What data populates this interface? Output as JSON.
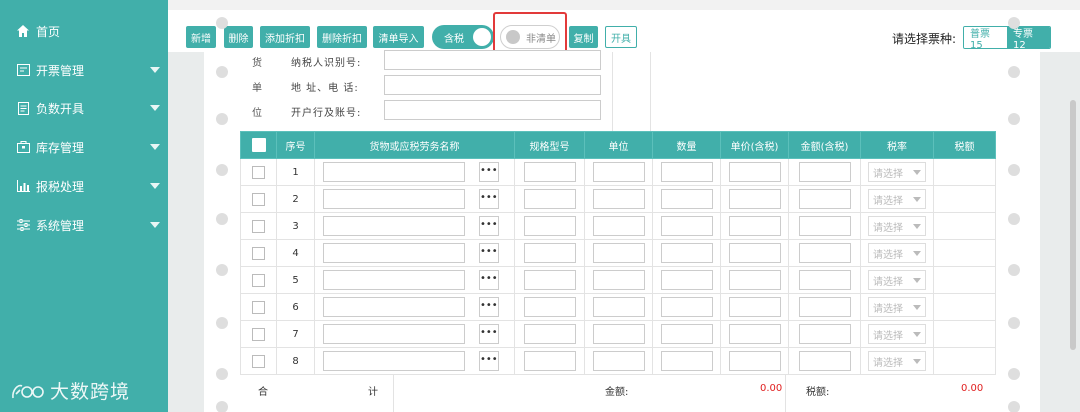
{
  "sidebar": {
    "items": [
      {
        "label": "首页",
        "icon": "home-icon",
        "has_caret": false
      },
      {
        "label": "开票管理",
        "icon": "invoice-icon",
        "has_caret": true
      },
      {
        "label": "负数开具",
        "icon": "document-icon",
        "has_caret": true
      },
      {
        "label": "库存管理",
        "icon": "inventory-icon",
        "has_caret": true
      },
      {
        "label": "报税处理",
        "icon": "bar-chart-icon",
        "has_caret": true
      },
      {
        "label": "系统管理",
        "icon": "sliders-icon",
        "has_caret": true
      }
    ],
    "logo_text": "大数跨境"
  },
  "toolbar": {
    "add_label": "新增",
    "delete_label": "删除",
    "add_discount_label": "添加折扣",
    "delete_discount_label": "删除折扣",
    "list_import_label": "清单导入",
    "tax_included_label": "含税",
    "non_list_label": "非清单",
    "copy_label": "复制",
    "issue_label": "开具"
  },
  "ticket": {
    "prompt": "请选择票种:",
    "normal_label": "普票 15",
    "special_label": "专票 12"
  },
  "buyer": {
    "side_chars": [
      "货",
      "单",
      "位"
    ],
    "fields": [
      "纳税人识别号:",
      "地 址、电 话:",
      "开户行及账号:"
    ]
  },
  "table": {
    "headers": [
      "序号",
      "货物或应税劳务名称",
      "规格型号",
      "单位",
      "数量",
      "单价(含税)",
      "金额(含税)",
      "税率",
      "税额"
    ],
    "rows": [
      "1",
      "2",
      "3",
      "4",
      "5",
      "6",
      "7",
      "8"
    ],
    "more_glyph": "•••",
    "rate_placeholder": "请选择"
  },
  "totals": {
    "label_left": "合",
    "label_right": "计",
    "amount_label": "金额:",
    "amount_value": "0.00",
    "tax_label": "税额:",
    "tax_value": "0.00"
  },
  "colors": {
    "accent": "#41afaa",
    "highlight": "#e23a3a",
    "totals_value": "#e02020"
  }
}
